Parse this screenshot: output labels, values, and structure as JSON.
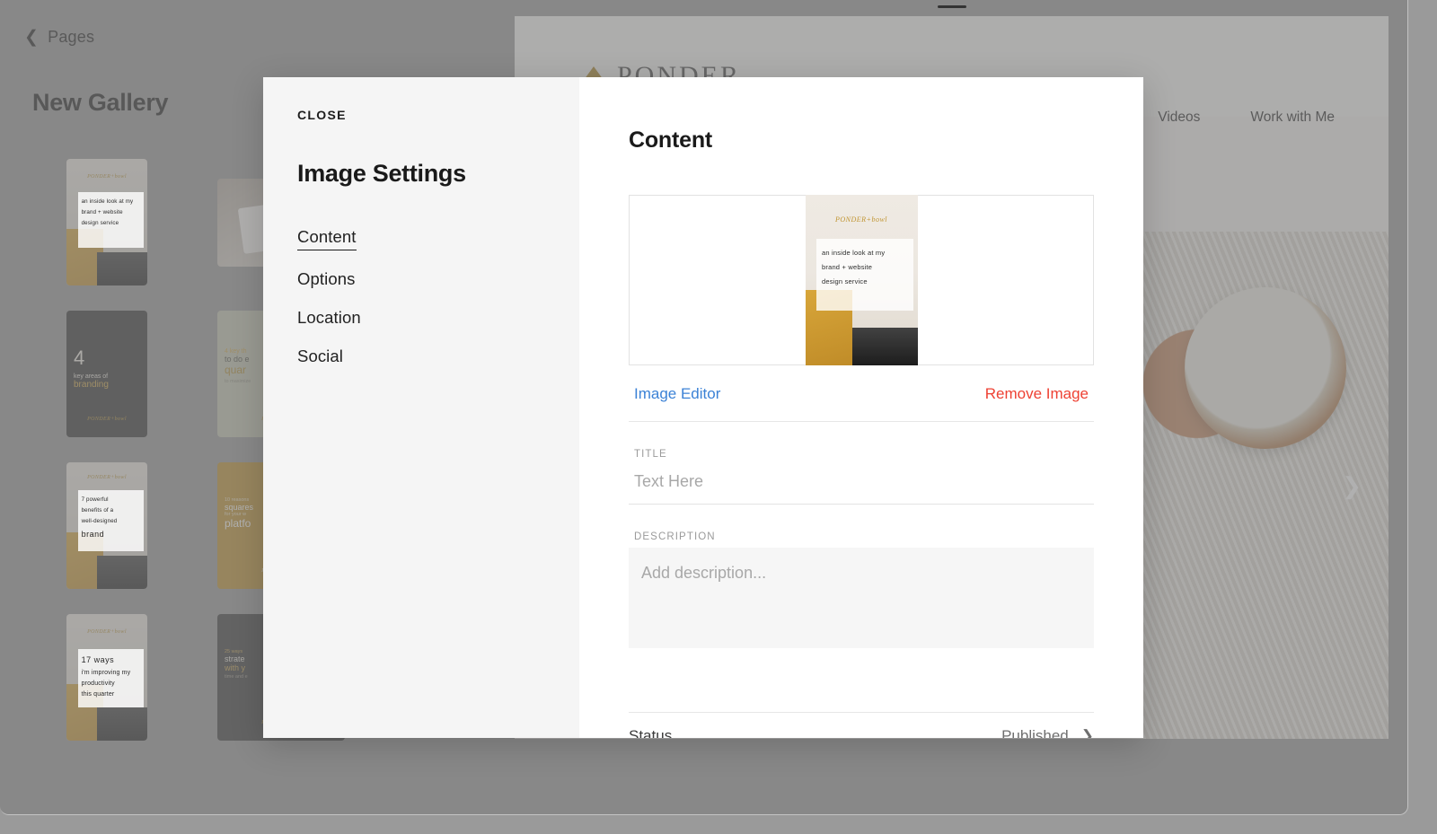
{
  "editor": {
    "back_label": "Pages",
    "back_icon": "chevron-left-icon",
    "page_title": "New Gallery"
  },
  "gallery_thumbnails": [
    {
      "id": "t1",
      "type": "photo-desk",
      "lines": [
        "an inside look at my",
        "brand + website",
        "design service"
      ],
      "brandmark": "PONDER+bowl"
    },
    {
      "id": "t2",
      "type": "photo-phone",
      "lines": [],
      "brandmark": ""
    },
    {
      "id": "t3",
      "type": "dark",
      "number": "4",
      "lines": [
        "key areas of",
        "branding"
      ],
      "brandmark": "PONDER+bowl"
    },
    {
      "id": "t4",
      "type": "sage",
      "lines": [
        "4 key th",
        "to do e",
        "quar",
        "to maximize"
      ],
      "brandmark": "PONDER+bowl"
    },
    {
      "id": "t5",
      "type": "photo-desk2",
      "lines": [
        "7 powerful",
        "benefits of a",
        "well-designed",
        "brand"
      ],
      "brandmark": "PONDER+bowl"
    },
    {
      "id": "t6",
      "type": "gold",
      "lines": [
        "10 reasons",
        "squares",
        "for your w",
        "platfo"
      ],
      "brandmark": "PONDER+bowl"
    },
    {
      "id": "t7",
      "type": "photo-desk3",
      "lines": [
        "17 ways",
        "i'm improving my",
        "productivity",
        "this quarter"
      ],
      "brandmark": "PONDER+bowl"
    },
    {
      "id": "t8",
      "type": "dark2",
      "lines": [
        "25 ways",
        "strate",
        "with y",
        "time and e"
      ],
      "brandmark": "PONDER+bowl"
    }
  ],
  "site_preview": {
    "logo_text": "PONDER",
    "nav_items": [
      "Videos",
      "Work with Me"
    ],
    "next_arrow_icon": "chevron-right-icon"
  },
  "modal": {
    "close_label": "CLOSE",
    "title": "Image Settings",
    "nav": [
      {
        "label": "Content",
        "active": true
      },
      {
        "label": "Options",
        "active": false
      },
      {
        "label": "Location",
        "active": false
      },
      {
        "label": "Social",
        "active": false
      }
    ],
    "section_title": "Content",
    "image_preview": {
      "brandmark": "PONDER+bowl",
      "lines": [
        "an inside look at my",
        "brand + website",
        "design service"
      ]
    },
    "actions": {
      "edit_label": "Image Editor",
      "edit_color": "#3b82d6",
      "remove_label": "Remove Image",
      "remove_color": "#ee4133"
    },
    "fields": {
      "title_label": "TITLE",
      "title_value": "",
      "title_placeholder": "Text Here",
      "description_label": "DESCRIPTION",
      "description_value": "",
      "description_placeholder": "Add description..."
    },
    "status": {
      "label": "Status",
      "value": "Published",
      "chevron_icon": "chevron-right-icon"
    }
  },
  "colors": {
    "scrim": "#959595",
    "sidebar_bg": "#f5f5f5",
    "panel_bg": "#ffffff",
    "link_blue": "#3b82d6",
    "link_red": "#ee4133"
  }
}
